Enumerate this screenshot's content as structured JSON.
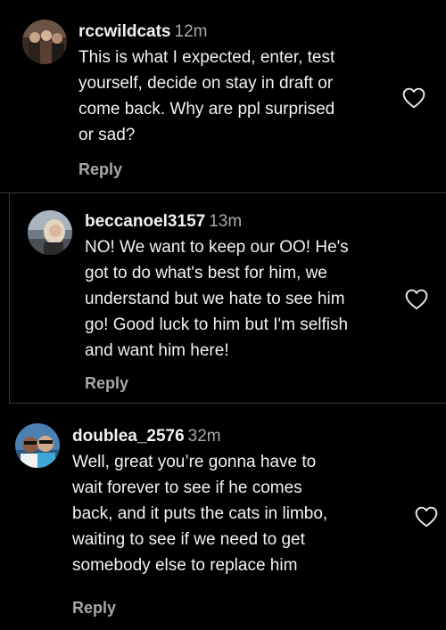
{
  "comments": [
    {
      "username": "rccwildcats",
      "time": "12m",
      "text": "This is what I expected, enter, test\nyourself, decide on stay in draft or\ncome back. Why are ppl surprised\nor sad?",
      "reply_label": "Reply",
      "avatar_icon": "group-photo-avatar",
      "like_icon": "heart-outline-icon"
    },
    {
      "username": "beccanoel3157",
      "time": "13m",
      "text": "NO! We want to keep our OO! He's\ngot to do what's best for him, we\nunderstand but we hate to see him\ngo! Good luck to him but I'm selfish\nand want him here!",
      "reply_label": "Reply",
      "avatar_icon": "person-photo-avatar",
      "like_icon": "heart-outline-icon"
    },
    {
      "username": "doublea_2576",
      "time": "32m",
      "text": "Well, great you’re gonna have to\nwait forever to see if he comes\nback, and it puts the cats in limbo,\nwaiting to see if we need to get\nsomebody else to replace him",
      "reply_label": "Reply",
      "avatar_icon": "couple-selfie-avatar",
      "like_icon": "heart-outline-icon"
    }
  ],
  "colors": {
    "background": "#000000",
    "text_primary": "#f2f2f2",
    "text_secondary": "#a8a8a8",
    "divider": "#3a3a3a"
  }
}
